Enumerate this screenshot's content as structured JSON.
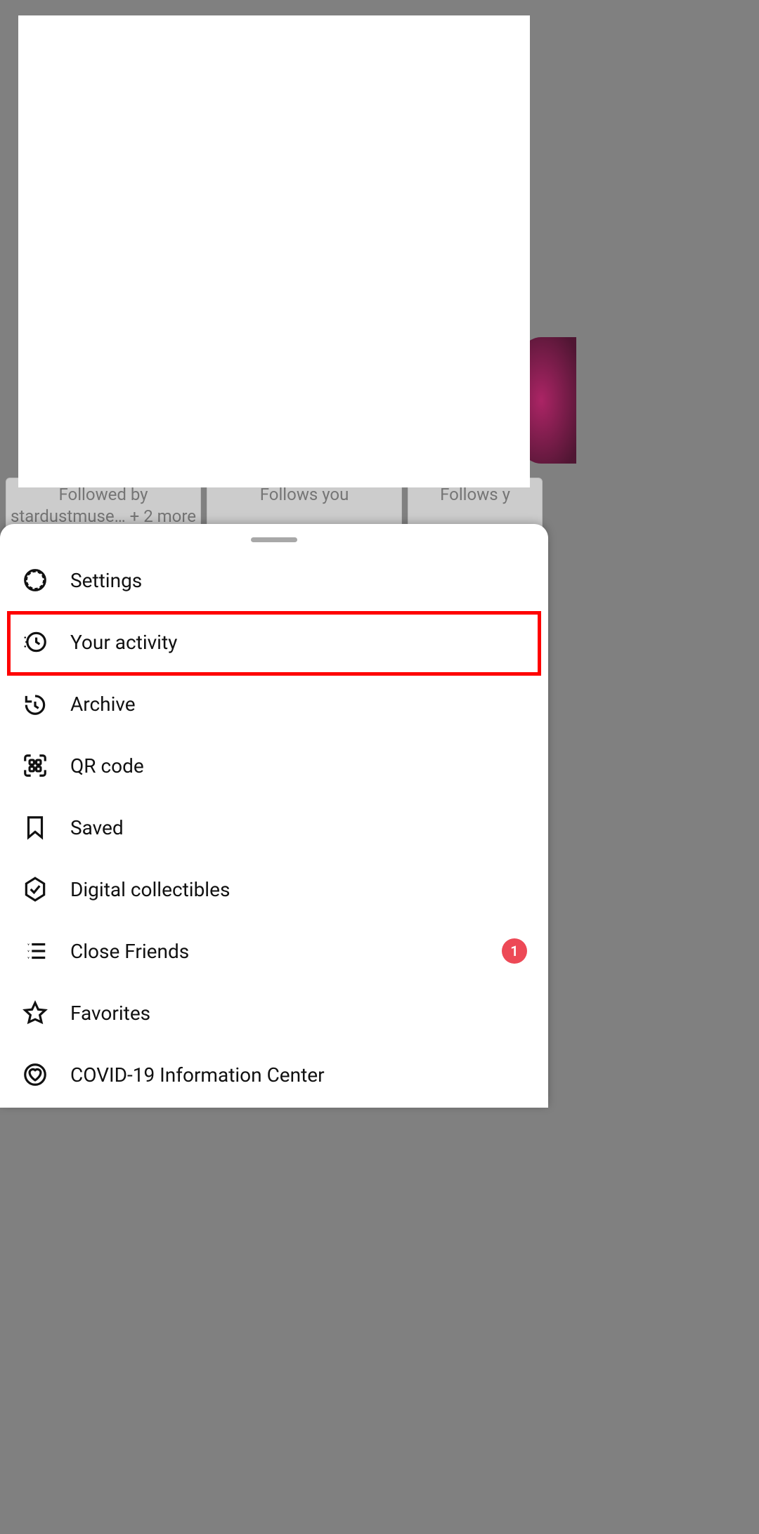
{
  "background": {
    "cards": [
      {
        "line1": "Followed by",
        "line2": "stardustmuse… + 2 more"
      },
      {
        "line1": "Follows you",
        "line2": ""
      },
      {
        "line1": "Follows y",
        "line2": ""
      }
    ]
  },
  "sheet": {
    "highlighted": "your_activity",
    "items": [
      {
        "key": "settings",
        "label": "Settings",
        "icon": "gear-icon",
        "badge": null
      },
      {
        "key": "your_activity",
        "label": "Your activity",
        "icon": "activity-icon",
        "badge": null
      },
      {
        "key": "archive",
        "label": "Archive",
        "icon": "archive-icon",
        "badge": null
      },
      {
        "key": "qr_code",
        "label": "QR code",
        "icon": "qr-icon",
        "badge": null
      },
      {
        "key": "saved",
        "label": "Saved",
        "icon": "saved-icon",
        "badge": null
      },
      {
        "key": "digital_collectibles",
        "label": "Digital collectibles",
        "icon": "hex-check-icon",
        "badge": null
      },
      {
        "key": "close_friends",
        "label": "Close Friends",
        "icon": "star-list-icon",
        "badge": "1"
      },
      {
        "key": "favorites",
        "label": "Favorites",
        "icon": "star-icon",
        "badge": null
      },
      {
        "key": "covid_info",
        "label": "COVID-19 Information Center",
        "icon": "heart-shield-icon",
        "badge": null
      }
    ]
  }
}
